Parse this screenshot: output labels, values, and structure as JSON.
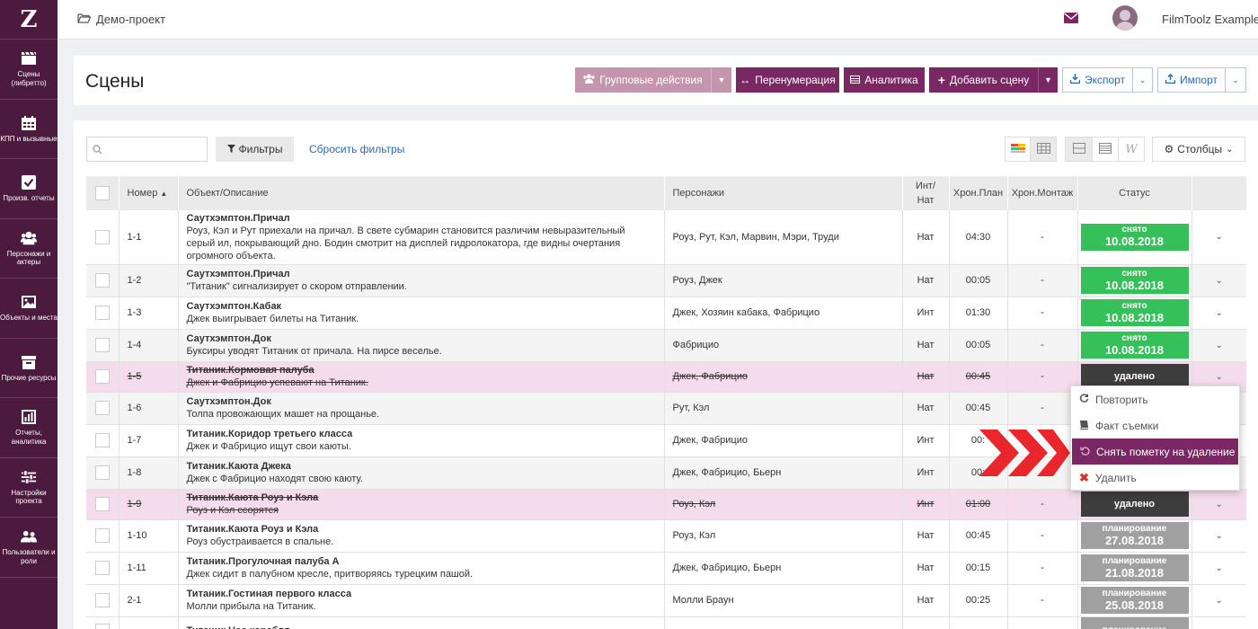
{
  "sidebar": {
    "logo": "Z",
    "items": [
      {
        "label": "Сцены (либретто)",
        "icon": "clapperboard-icon"
      },
      {
        "label": "КПП и вызывные",
        "icon": "calendar-icon"
      },
      {
        "label": "Произв. отчеты",
        "icon": "checkbox-icon"
      },
      {
        "label": "Персонажи и актеры",
        "icon": "people-icon"
      },
      {
        "label": "Объекты и места",
        "icon": "image-icon"
      },
      {
        "label": "Прочие ресурсы",
        "icon": "box-icon"
      },
      {
        "label": "Отчеты, аналитика",
        "icon": "chart-icon"
      },
      {
        "label": "Настройки проекта",
        "icon": "sliders-icon"
      },
      {
        "label": "Пользователи и роли",
        "icon": "users-icon"
      }
    ]
  },
  "topbar": {
    "project": "Демо-проект",
    "user": "FilmToolz Example"
  },
  "header": {
    "title": "Сцены",
    "group_actions": "Групповые действия",
    "renumber": "Перенумерация",
    "analytics": "Аналитика",
    "add_scene": "Добавить сцену",
    "export": "Экспорт",
    "import": "Импорт"
  },
  "toolbar": {
    "search_placeholder": "",
    "filters": "Фильтры",
    "reset_filters": "Сбросить фильтры",
    "columns": "Столбцы"
  },
  "table": {
    "headers": {
      "number": "Номер",
      "object": "Объект/Описание",
      "characters": "Персонажи",
      "int_nat_1": "Инт/",
      "int_nat_2": "Нат",
      "plan": "Хрон.План",
      "montage": "Хрон.Монтаж",
      "status": "Статус"
    },
    "rows": [
      {
        "num": "1-1",
        "obj": "Саутхэмптон.Причал",
        "desc": "Роуз, Кэл и Рут приехали на причал. В свете субмарин становится различим невыразительный серый ил, покрывающий дно. Бодин смотрит на дисплей гидролокатора, где видны очертания огромного объекта.",
        "chars": "Роуз, Рут, Кэл, Марвин, Мэри, Труди",
        "in": "Нат",
        "plan": "04:30",
        "mont": "-",
        "s1": "снято",
        "s2": "10.08.2018"
      },
      {
        "num": "1-2",
        "obj": "Саутхэмптон.Причал",
        "desc": "\"Титаник\" сигнализирует о скором отправлении.",
        "chars": "Роуз, Джек",
        "in": "Нат",
        "plan": "00:05",
        "mont": "-",
        "s1": "снято",
        "s2": "10.08.2018"
      },
      {
        "num": "1-3",
        "obj": "Саутхэмптон.Кабак",
        "desc": "Джек выигрывает билеты на Титаник.",
        "chars": "Джек, Хозяин кабака, Фабрицио",
        "in": "Инт",
        "plan": "01:30",
        "mont": "-",
        "s1": "снято",
        "s2": "10.08.2018"
      },
      {
        "num": "1-4",
        "obj": "Саутхэмптон.Док",
        "desc": "Буксиры уводят Титаник от причала. На пирсе веселье.",
        "chars": "Фабрицио",
        "in": "Нат",
        "plan": "00:05",
        "mont": "-",
        "s1": "снято",
        "s2": "10.08.2018"
      },
      {
        "num": "1-5",
        "obj": "Титаник.Кормовая палуба",
        "desc": "Джек и Фабрицио успевают на Титаник.",
        "chars": "Джек, Фабрицио",
        "in": "Нат",
        "plan": "00:45",
        "mont": "-",
        "s1": "удалено",
        "s2": ""
      },
      {
        "num": "1-6",
        "obj": "Саутхэмптон.Док",
        "desc": "Толпа провожающих машет на прощанье.",
        "chars": "Рут, Кэл",
        "in": "Нат",
        "plan": "00:45",
        "mont": "-",
        "s1": "",
        "s2": ""
      },
      {
        "num": "1-7",
        "obj": "Титаник.Коридор третьего класса",
        "desc": "Джек и Фабрицио ищут свои каюты.",
        "chars": "Джек, Фабрицио",
        "in": "Инт",
        "plan": "00:",
        "mont": "",
        "s1": "",
        "s2": ""
      },
      {
        "num": "1-8",
        "obj": "Титаник.Каюта Джека",
        "desc": "Джек с Фабрицио находят свою каюту.",
        "chars": "Джек, Фабрицио, Бьерн",
        "in": "Инт",
        "plan": "00:",
        "mont": "",
        "s1": "",
        "s2": ""
      },
      {
        "num": "1-9",
        "obj": "Титаник.Каюта Роуз и Кэла",
        "desc": "Роуз и Кэл ссорятся",
        "chars": "Роуз, Кэл",
        "in": "Инт",
        "plan": "01:00",
        "mont": "-",
        "s1": "удалено",
        "s2": ""
      },
      {
        "num": "1-10",
        "obj": "Титаник.Каюта Роуз и Кэла",
        "desc": "Роуз обустраивается в спальне.",
        "chars": "Роуз, Кэл",
        "in": "Нат",
        "plan": "00:45",
        "mont": "-",
        "s1": "планирование",
        "s2": "27.08.2018"
      },
      {
        "num": "1-11",
        "obj": "Титаник.Прогулочная палуба А",
        "desc": "Джек сидит в палубном кресле, притворяясь турецким пашой.",
        "chars": "Джек, Фабрицио, Бьерн",
        "in": "Нат",
        "plan": "00:15",
        "mont": "-",
        "s1": "планирование",
        "s2": "21.08.2018"
      },
      {
        "num": "2-1",
        "obj": "Титаник.Гостиная первого класса",
        "desc": "Молли прибыла на Титаник.",
        "chars": "Молли Браун",
        "in": "Нат",
        "plan": "00:25",
        "mont": "-",
        "s1": "планирование",
        "s2": "25.08.2018"
      },
      {
        "num": "",
        "obj": "Титаник.Нос корабля",
        "desc": "",
        "chars": "",
        "in": "",
        "plan": "",
        "mont": "",
        "s1": "планирование",
        "s2": ""
      }
    ]
  },
  "menu": {
    "repeat": "Повторить",
    "fact": "Факт съемки",
    "unmark": "Снять пометку на удаление",
    "delete": "Удалить"
  },
  "colors": {
    "sidebar": "#4b1a3e",
    "accent": "#7a2863",
    "shot": "#35c05a",
    "deleted": "#3d3d3d",
    "planning": "#a0a0a0",
    "arrow": "#e8262b"
  }
}
